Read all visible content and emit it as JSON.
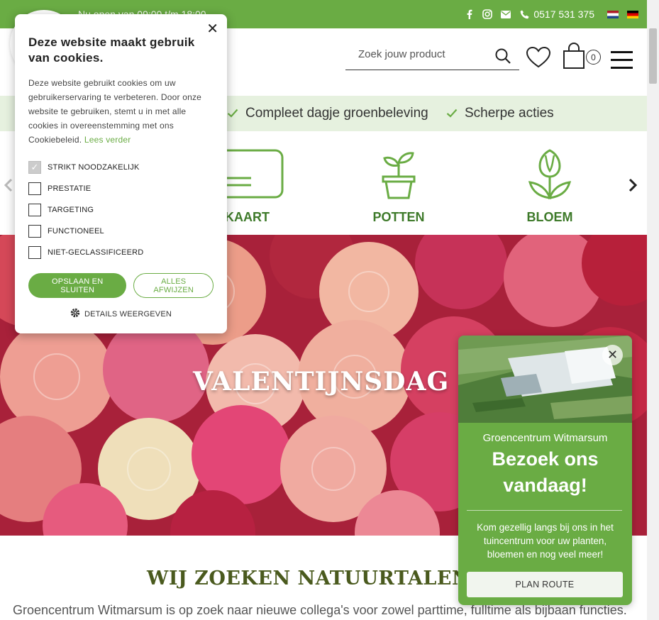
{
  "topbar": {
    "hours": "Nu open van 09:00 t/m 18:00",
    "phone": "0517 531 375",
    "icons": [
      "facebook-icon",
      "instagram-icon",
      "mail-icon",
      "phone-icon"
    ],
    "languages": [
      "nl",
      "de"
    ]
  },
  "header": {
    "search_placeholder": "Zoek jouw product",
    "cart_count": "0"
  },
  "usp": {
    "items": [
      "Compleet dagje groenbeleving",
      "Scherpe acties"
    ]
  },
  "categories": {
    "items": [
      {
        "label": "CADEAUKAART",
        "icon": "giftcard-icon"
      },
      {
        "label": "POTTEN",
        "icon": "pot-plant-icon"
      },
      {
        "label": "BLOEM",
        "icon": "tulip-icon"
      }
    ]
  },
  "hero": {
    "title": "VALENTIJNSDAG"
  },
  "section": {
    "title": "WIJ ZOEKEN NATUURTALENT",
    "text": "Groencentrum Witmarsum is op zoek naar nieuwe collega's voor zowel parttime, fulltime als bijbaan functies."
  },
  "cookie": {
    "title": "Deze website maakt gebruik van cookies.",
    "body": "Deze website gebruikt cookies om uw gebruikerservaring te verbeteren. Door onze website te gebruiken, stemt u in met alle cookies in overeenstemming met ons Cookiebeleid.",
    "read_more": "Lees verder",
    "options": [
      {
        "label": "STRIKT NOODZAKELIJK",
        "checked": true
      },
      {
        "label": "PRESTATIE",
        "checked": false
      },
      {
        "label": "TARGETING",
        "checked": false
      },
      {
        "label": "FUNCTIONEEL",
        "checked": false
      },
      {
        "label": "NIET-GECLASSIFICEERD",
        "checked": false
      }
    ],
    "save_label": "OPSLAAN EN SLUITEN",
    "reject_label": "ALLES AFWIJZEN",
    "details_label": "DETAILS WEERGEVEN"
  },
  "popup": {
    "subtitle": "Groencentrum Witmarsum",
    "headline_line1": "Bezoek ons",
    "headline_line2": "vandaag!",
    "text": "Kom gezellig langs bij ons in het tuincentrum voor uw planten, bloemen en nog veel meer!",
    "button": "PLAN ROUTE"
  },
  "colors": {
    "brand_green": "#6aac44",
    "dark_green": "#3e7a2a",
    "usp_bg": "#e6f1df"
  }
}
